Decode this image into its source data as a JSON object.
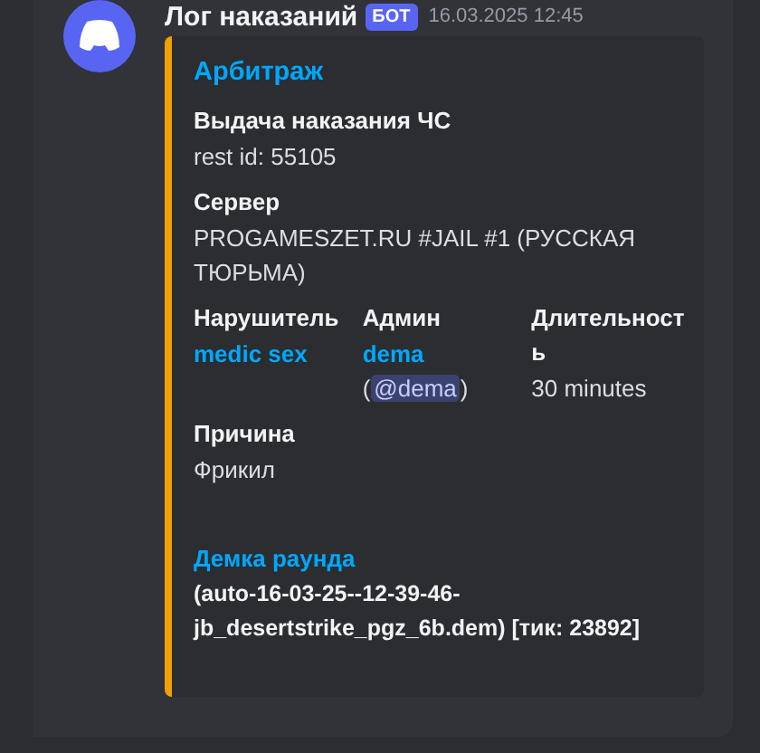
{
  "message": {
    "author": "Лог наказаний",
    "bot_tag": "БОТ",
    "timestamp": "16.03.2025 12:45"
  },
  "embed": {
    "title": "Арбитраж",
    "rows": [
      [
        {
          "name": "Выдача наказания ЧС",
          "kind": "plain",
          "lines": [
            {
              "kind": "text",
              "text": "rest id: 55105"
            }
          ]
        }
      ],
      [
        {
          "name": "Сервер",
          "kind": "plain",
          "lines": [
            {
              "kind": "text",
              "text": "PROGAMESZET.RU #JAIL #1 (РУССКАЯ ТЮРЬМА)"
            }
          ]
        }
      ],
      [
        {
          "name": "Нарушитель",
          "kind": "plain",
          "lines": [
            {
              "kind": "link",
              "text": "medic sex"
            }
          ]
        },
        {
          "name": "Админ",
          "kind": "plain",
          "lines": [
            {
              "kind": "link",
              "text": "dema"
            },
            {
              "kind": "mention",
              "open": "(",
              "text": "@dema",
              "close": ")"
            }
          ]
        },
        {
          "name": "Длительность",
          "kind": "plain",
          "lines": [
            {
              "kind": "text",
              "text": "30 minutes"
            }
          ]
        }
      ],
      [
        {
          "name": "Причина",
          "kind": "plain",
          "lines": [
            {
              "kind": "text",
              "text": "Фрикил"
            }
          ]
        }
      ],
      [
        {
          "name": "Демка раунда",
          "kind": "link",
          "lines": [
            {
              "kind": "bold",
              "text": "(auto-16-03-25--12-39-46-jb_desertstrike_pgz_6b.dem) [тик: 23892]"
            }
          ]
        }
      ]
    ]
  }
}
